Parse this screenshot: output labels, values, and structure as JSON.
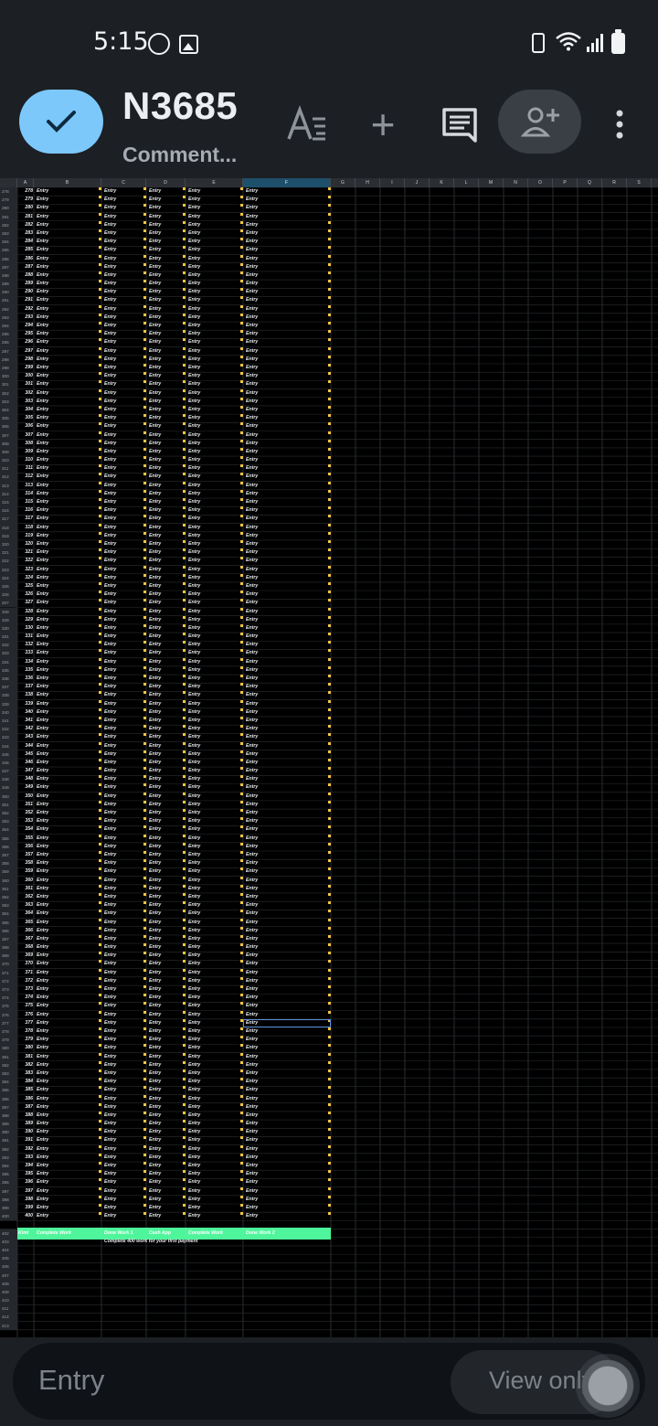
{
  "status_bar": {
    "time": "5:15",
    "icons": [
      "whatsapp-icon",
      "image-icon",
      "recycle-icon",
      "wifi-icon",
      "signal-icon",
      "battery-icon"
    ]
  },
  "app_bar": {
    "title": "N3685",
    "subtitle": "Comment...",
    "icons": [
      "check-icon",
      "text-format-icon",
      "plus-icon",
      "comment-icon",
      "add-person-icon",
      "more-vert-icon"
    ]
  },
  "colors": {
    "accent_button": "#7cc8fb",
    "selected_column": "#1e4f6b",
    "summary_row": "#4ef59b",
    "selection_border": "#5b8fd9",
    "note_marker": "#f4c542"
  },
  "sheet": {
    "columns": [
      "A",
      "B",
      "C",
      "D",
      "E",
      "F",
      "G",
      "H",
      "I",
      "J",
      "K",
      "L",
      "M",
      "N",
      "O",
      "P",
      "Q",
      "R",
      "S"
    ],
    "selected_column": "F",
    "entry_label": "Entry",
    "entry_rows": {
      "first_row_number": 278,
      "last_row_number": 400,
      "first_index": 278
    },
    "selected_cell": "F377",
    "rows_after_summary": [
      "403",
      "404",
      "405",
      "406",
      "407",
      "408",
      "409",
      "410",
      "411",
      "412",
      "413"
    ],
    "summary_row": {
      "row_number": "402",
      "cells": [
        "Kimi",
        "Complete Work",
        "Done Work 1",
        "Cash App",
        "Complete Work",
        "Done Work 2"
      ]
    },
    "note_row": {
      "row_number": "403",
      "text": "Complete 400 work for your first payment"
    }
  },
  "bottom_bar": {
    "cell_value": "Entry",
    "view_only": "View only"
  }
}
